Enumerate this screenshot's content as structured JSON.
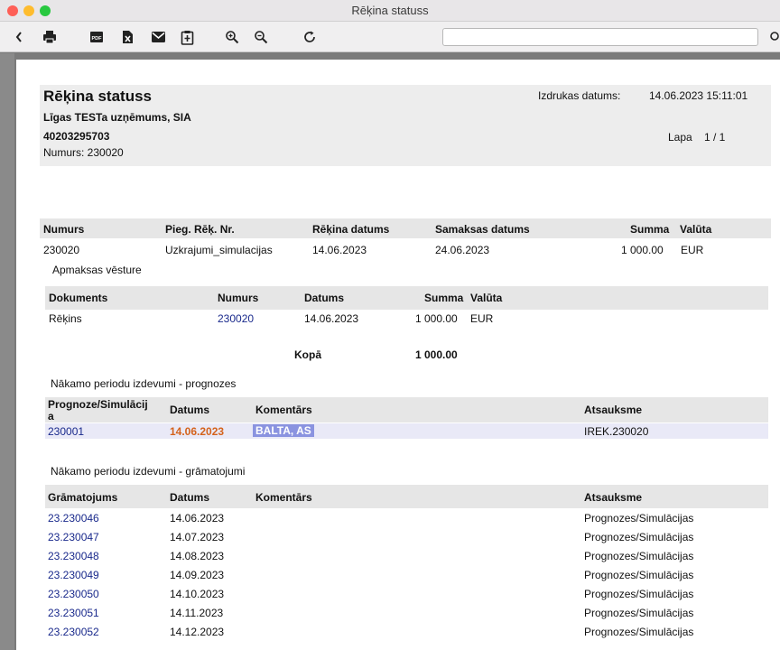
{
  "window": {
    "title": "Rēķina statuss"
  },
  "toolbar": {
    "icons": [
      "back-icon",
      "print-icon",
      "pdf-icon",
      "excel-icon",
      "mail-icon",
      "clipboard-icon",
      "zoom-in-icon",
      "zoom-out-icon",
      "refresh-icon",
      "search-icon"
    ],
    "pdf_label": "PDF",
    "search_value": ""
  },
  "report": {
    "title": "Rēķina statuss",
    "company": "Līgas TESTa uzņēmums, SIA",
    "reg_no": "40203295703",
    "number_line": "Numurs: 230020",
    "print_date_label": "Izdrukas datums:",
    "print_date": "14.06.2023 15:11:01",
    "page_label": "Lapa",
    "page_value": "1 / 1"
  },
  "invoice": {
    "headers": [
      "Numurs",
      "Pieg. Rēķ. Nr.",
      "Rēķina datums",
      "Samaksas datums",
      "Summa",
      "Valūta"
    ],
    "row": [
      "230020",
      "Uzkrajumi_simulacijas",
      "14.06.2023",
      "24.06.2023",
      "1 000.00",
      "EUR"
    ]
  },
  "payment_history": {
    "title": "Apmaksas vēsture",
    "headers": [
      "Dokuments",
      "Numurs",
      "Datums",
      "Summa",
      "Valūta"
    ],
    "row": [
      "Rēķins",
      "230020",
      "14.06.2023",
      "1 000.00",
      "EUR"
    ],
    "total_label": "Kopā",
    "total_value": "1 000.00"
  },
  "forecasts": {
    "title": "Nākamo periodu izdevumi - prognozes",
    "headers": [
      "Prognoze/Simulācij",
      "a",
      "Datums",
      "Komentārs",
      "Atsauksme"
    ],
    "row": [
      "230001",
      "14.06.2023",
      "BALTA, AS",
      "IREK.230020"
    ]
  },
  "postings": {
    "title": "Nākamo periodu izdevumi - grāmatojumi",
    "headers": [
      "Grāmatojums",
      "Datums",
      "Komentārs",
      "Atsauksme"
    ],
    "rows": [
      [
        "23.230046",
        "14.06.2023",
        "Prognozes/Simulācijas"
      ],
      [
        "23.230047",
        "14.07.2023",
        "Prognozes/Simulācijas"
      ],
      [
        "23.230048",
        "14.08.2023",
        "Prognozes/Simulācijas"
      ],
      [
        "23.230049",
        "14.09.2023",
        "Prognozes/Simulācijas"
      ],
      [
        "23.230050",
        "14.10.2023",
        "Prognozes/Simulācijas"
      ],
      [
        "23.230051",
        "14.11.2023",
        "Prognozes/Simulācijas"
      ],
      [
        "23.230052",
        "14.12.2023",
        "Prognozes/Simulācijas"
      ]
    ]
  }
}
